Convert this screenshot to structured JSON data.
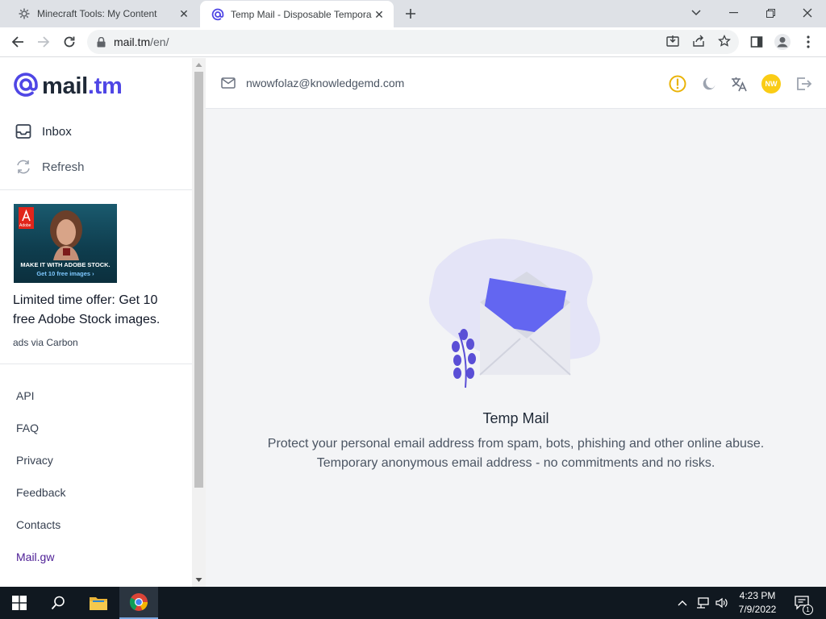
{
  "browser": {
    "tabs": [
      {
        "title": "Minecraft Tools: My Content",
        "icon": "gear-icon",
        "active": false
      },
      {
        "title": "Temp Mail - Disposable Tempora",
        "icon": "at-icon",
        "active": true
      }
    ],
    "url_host": "mail.tm",
    "url_path": "/en/"
  },
  "sidebar": {
    "logo_text": "mail",
    "logo_tld": ".tm",
    "nav": [
      {
        "label": "Inbox",
        "icon": "inbox-icon"
      },
      {
        "label": "Refresh",
        "icon": "refresh-icon"
      }
    ],
    "ad": {
      "image_caption": "MAKE IT WITH ADOBE STOCK.",
      "image_subcaption": "Get 10 free images ›",
      "brand": "Adobe",
      "text": "Limited time offer: Get 10 free Adobe Stock images.",
      "via": "ads via Carbon"
    },
    "links": [
      "API",
      "FAQ",
      "Privacy",
      "Feedback",
      "Contacts",
      "Mail.gw"
    ]
  },
  "header": {
    "email": "nwowfolaz@knowledgemd.com",
    "avatar_initials": "NW"
  },
  "empty_state": {
    "title": "Temp Mail",
    "line1": "Protect your personal email address from spam, bots, phishing and other online abuse.",
    "line2": "Temporary anonymous email address - no commitments and no risks."
  },
  "taskbar": {
    "time": "4:23 PM",
    "date": "7/9/2022",
    "notification_count": "1"
  },
  "colors": {
    "brand": "#4f46e5",
    "warning": "#eab308",
    "avatar": "#facc15"
  }
}
